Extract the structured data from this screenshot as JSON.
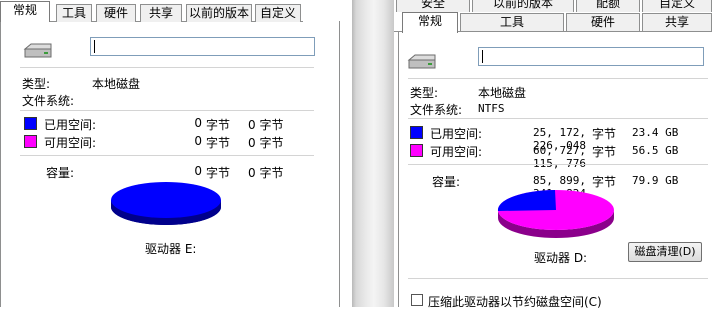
{
  "left": {
    "tabs": [
      "常规",
      "工具",
      "硬件",
      "共享",
      "以前的版本",
      "自定义"
    ],
    "type_label": "类型:",
    "type_value": "本地磁盘",
    "fs_label": "文件系统:",
    "fs_value": "",
    "used": {
      "label": "已用空间:",
      "bytes": "0",
      "unit": "字节",
      "size": "0 字节"
    },
    "free": {
      "label": "可用空间:",
      "bytes": "0",
      "unit": "字节",
      "size": "0 字节"
    },
    "capacity": {
      "label": "容量:",
      "bytes": "0",
      "unit": "字节",
      "size": "0 字节"
    },
    "drive_label": "驱动器 E:"
  },
  "right": {
    "tabs_top": [
      "安全",
      "以前的版本",
      "配额",
      "自定义"
    ],
    "tabs_bottom": [
      "常规",
      "工具",
      "硬件",
      "共享"
    ],
    "type_label": "类型:",
    "type_value": "本地磁盘",
    "fs_label": "文件系统:",
    "fs_value": "NTFS",
    "used": {
      "label": "已用空间:",
      "bytes": "25, 172, 226, 048",
      "unit": "字节",
      "size": "23.4 GB"
    },
    "free": {
      "label": "可用空间:",
      "bytes": "60, 727, 115, 776",
      "unit": "字节",
      "size": "56.5 GB"
    },
    "capacity": {
      "label": "容量:",
      "bytes": "85, 899, 341, 824",
      "unit": "字节",
      "size": "79.9 GB"
    },
    "drive_label": "驱动器 D:",
    "cleanup_button": "磁盘清理(D)",
    "compress_checkbox": "压缩此驱动器以节约磁盘空间(C)"
  },
  "colors": {
    "used": "#0000ff",
    "free": "#ff00ff"
  }
}
